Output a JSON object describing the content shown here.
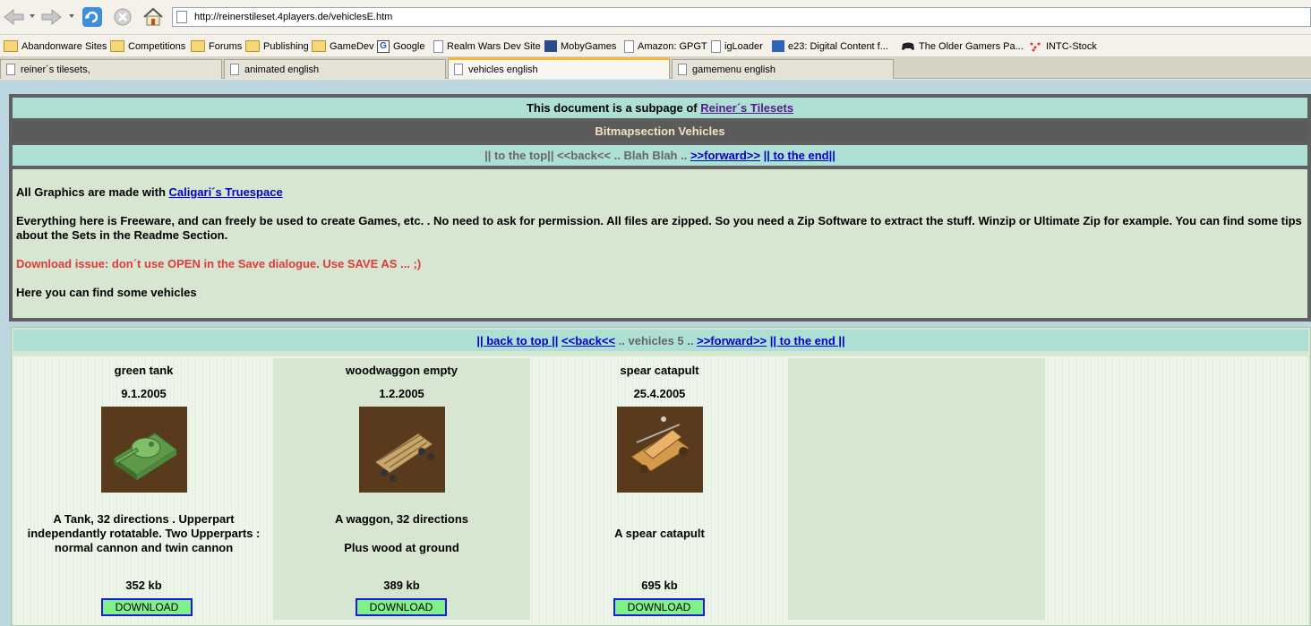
{
  "browser": {
    "url": "http://reinerstileset.4players.de/vehiclesE.htm"
  },
  "bookmarks": [
    {
      "label": "Abandonware Sites",
      "icon": "folder-icon"
    },
    {
      "label": "Competitions",
      "icon": "folder-icon"
    },
    {
      "label": "Forums",
      "icon": "folder-icon"
    },
    {
      "label": "Publishing",
      "icon": "folder-icon"
    },
    {
      "label": "GameDev",
      "icon": "folder-icon"
    },
    {
      "label": "Google",
      "icon": "google-icon"
    },
    {
      "label": "Realm Wars Dev Site",
      "icon": "page-icon"
    },
    {
      "label": "MobyGames",
      "icon": "mobygames-icon"
    },
    {
      "label": "Amazon: GPGT",
      "icon": "page-icon"
    },
    {
      "label": "igLoader",
      "icon": "page-icon"
    },
    {
      "label": "e23: Digital Content f...",
      "icon": "e23-icon"
    },
    {
      "label": "The Older Gamers Pa...",
      "icon": "gamepad-icon"
    },
    {
      "label": "INTC-Stock",
      "icon": "stock-icon"
    }
  ],
  "tabs": [
    {
      "label": "reiner´s tilesets,",
      "active": false
    },
    {
      "label": "animated english",
      "active": false
    },
    {
      "label": "vehicles english",
      "active": true
    },
    {
      "label": "gamemenu english",
      "active": false
    }
  ],
  "page": {
    "subpage_prefix": "This document is a subpage of ",
    "subpage_link": "Reiner´s Tilesets",
    "section_title": "Bitmapsection Vehicles",
    "nav1": {
      "top": "|| to the top||",
      "back": "<<back<<",
      "middle": " .. Blah Blah .. ",
      "forward": ">>forward>>",
      "end": "|| to the end||"
    },
    "intro_prefix": "All Graphics are made with ",
    "intro_link": "Caligari´s Truespace",
    "freeware_text": "Everything here is Freeware, and can freely be used to create Games, etc. . No need to ask for permission. All files are zipped. So you need a Zip Software to extract the stuff. Winzip or Ultimate Zip for example. You can find some tips about the Sets in the Readme Section.",
    "download_issue": "Download issue: don´t use OPEN in the Save dialogue. Use SAVE AS ... ;)",
    "here_text": "Here you can find some vehicles",
    "nav2": {
      "top": "|| back to top ||",
      "back": "<<back<<",
      "middle": " .. vehicles 5 .. ",
      "forward": ">>forward>>",
      "end": "|| to the end ||"
    },
    "vehicles": [
      {
        "name": "green tank",
        "date": "9.1.2005",
        "desc": "A Tank, 32 directions . Upperpart independantly rotatable. Two Upperparts : normal cannon and twin cannon",
        "size": "352 kb",
        "button": "DOWNLOAD"
      },
      {
        "name": "woodwaggon empty",
        "date": "1.2.2005",
        "desc1": "A waggon, 32 directions",
        "desc2": "Plus wood at ground",
        "size": "389 kb",
        "button": "DOWNLOAD"
      },
      {
        "name": "spear catapult",
        "date": "25.4.2005",
        "desc": "A spear catapult",
        "size": "695 kb",
        "button": "DOWNLOAD"
      }
    ]
  }
}
